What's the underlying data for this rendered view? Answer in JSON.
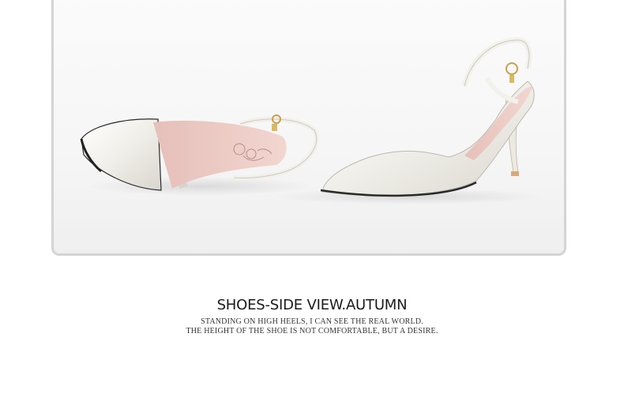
{
  "caption": {
    "title": "SHOES-SIDE VIEW.AUTUMN",
    "line1": "STANDING ON HIGH HEELS, I CAN SEE THE REAL WORLD.",
    "line2": "THE HEIGHT OF THE SHOE IS NOT COMFORTABLE, BUT A DESIRE."
  },
  "colors": {
    "frame_border": "#d4d4d4",
    "shoe_leather": "#f1efe9",
    "shoe_lining": "#e8c6c0",
    "text": "#1a1a1a"
  }
}
